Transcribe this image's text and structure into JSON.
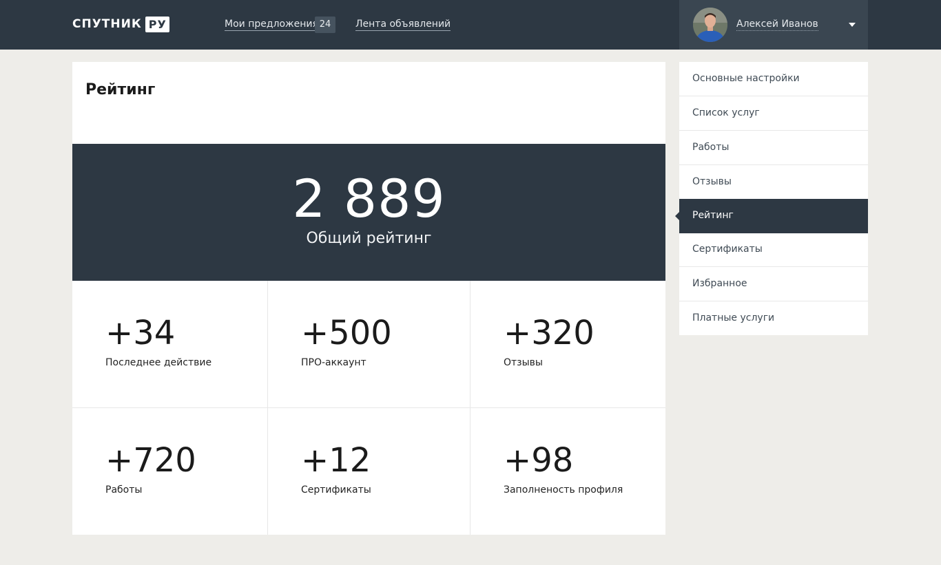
{
  "header": {
    "logo_text": "СПУТНИК",
    "logo_badge": "РУ",
    "nav": {
      "offers_label": "Мои предложения",
      "offers_count": "24",
      "feed_label": "Лента объявлений"
    },
    "user": {
      "name": "Алексей Иванов"
    }
  },
  "page": {
    "title": "Рейтинг",
    "total_value": "2 889",
    "total_label": "Общий рейтинг",
    "stats": [
      {
        "value": "+34",
        "label": "Последнее действие"
      },
      {
        "value": "+500",
        "label": "ПРО-аккаунт"
      },
      {
        "value": "+320",
        "label": "Отзывы"
      },
      {
        "value": "+720",
        "label": "Работы"
      },
      {
        "value": "+12",
        "label": "Сертификаты"
      },
      {
        "value": "+98",
        "label": "Заполненость профиля"
      }
    ]
  },
  "side_menu": {
    "items": [
      {
        "label": "Основные настройки"
      },
      {
        "label": "Список услуг"
      },
      {
        "label": "Работы"
      },
      {
        "label": "Отзывы"
      },
      {
        "label": "Рейтинг",
        "active": true
      },
      {
        "label": "Сертификаты"
      },
      {
        "label": "Избранное"
      },
      {
        "label": "Платные услуги"
      }
    ]
  },
  "colors": {
    "header_bg": "#2d3843",
    "page_bg": "#eeede9",
    "card_bg": "#ffffff",
    "accent_dark": "#2d3843"
  }
}
